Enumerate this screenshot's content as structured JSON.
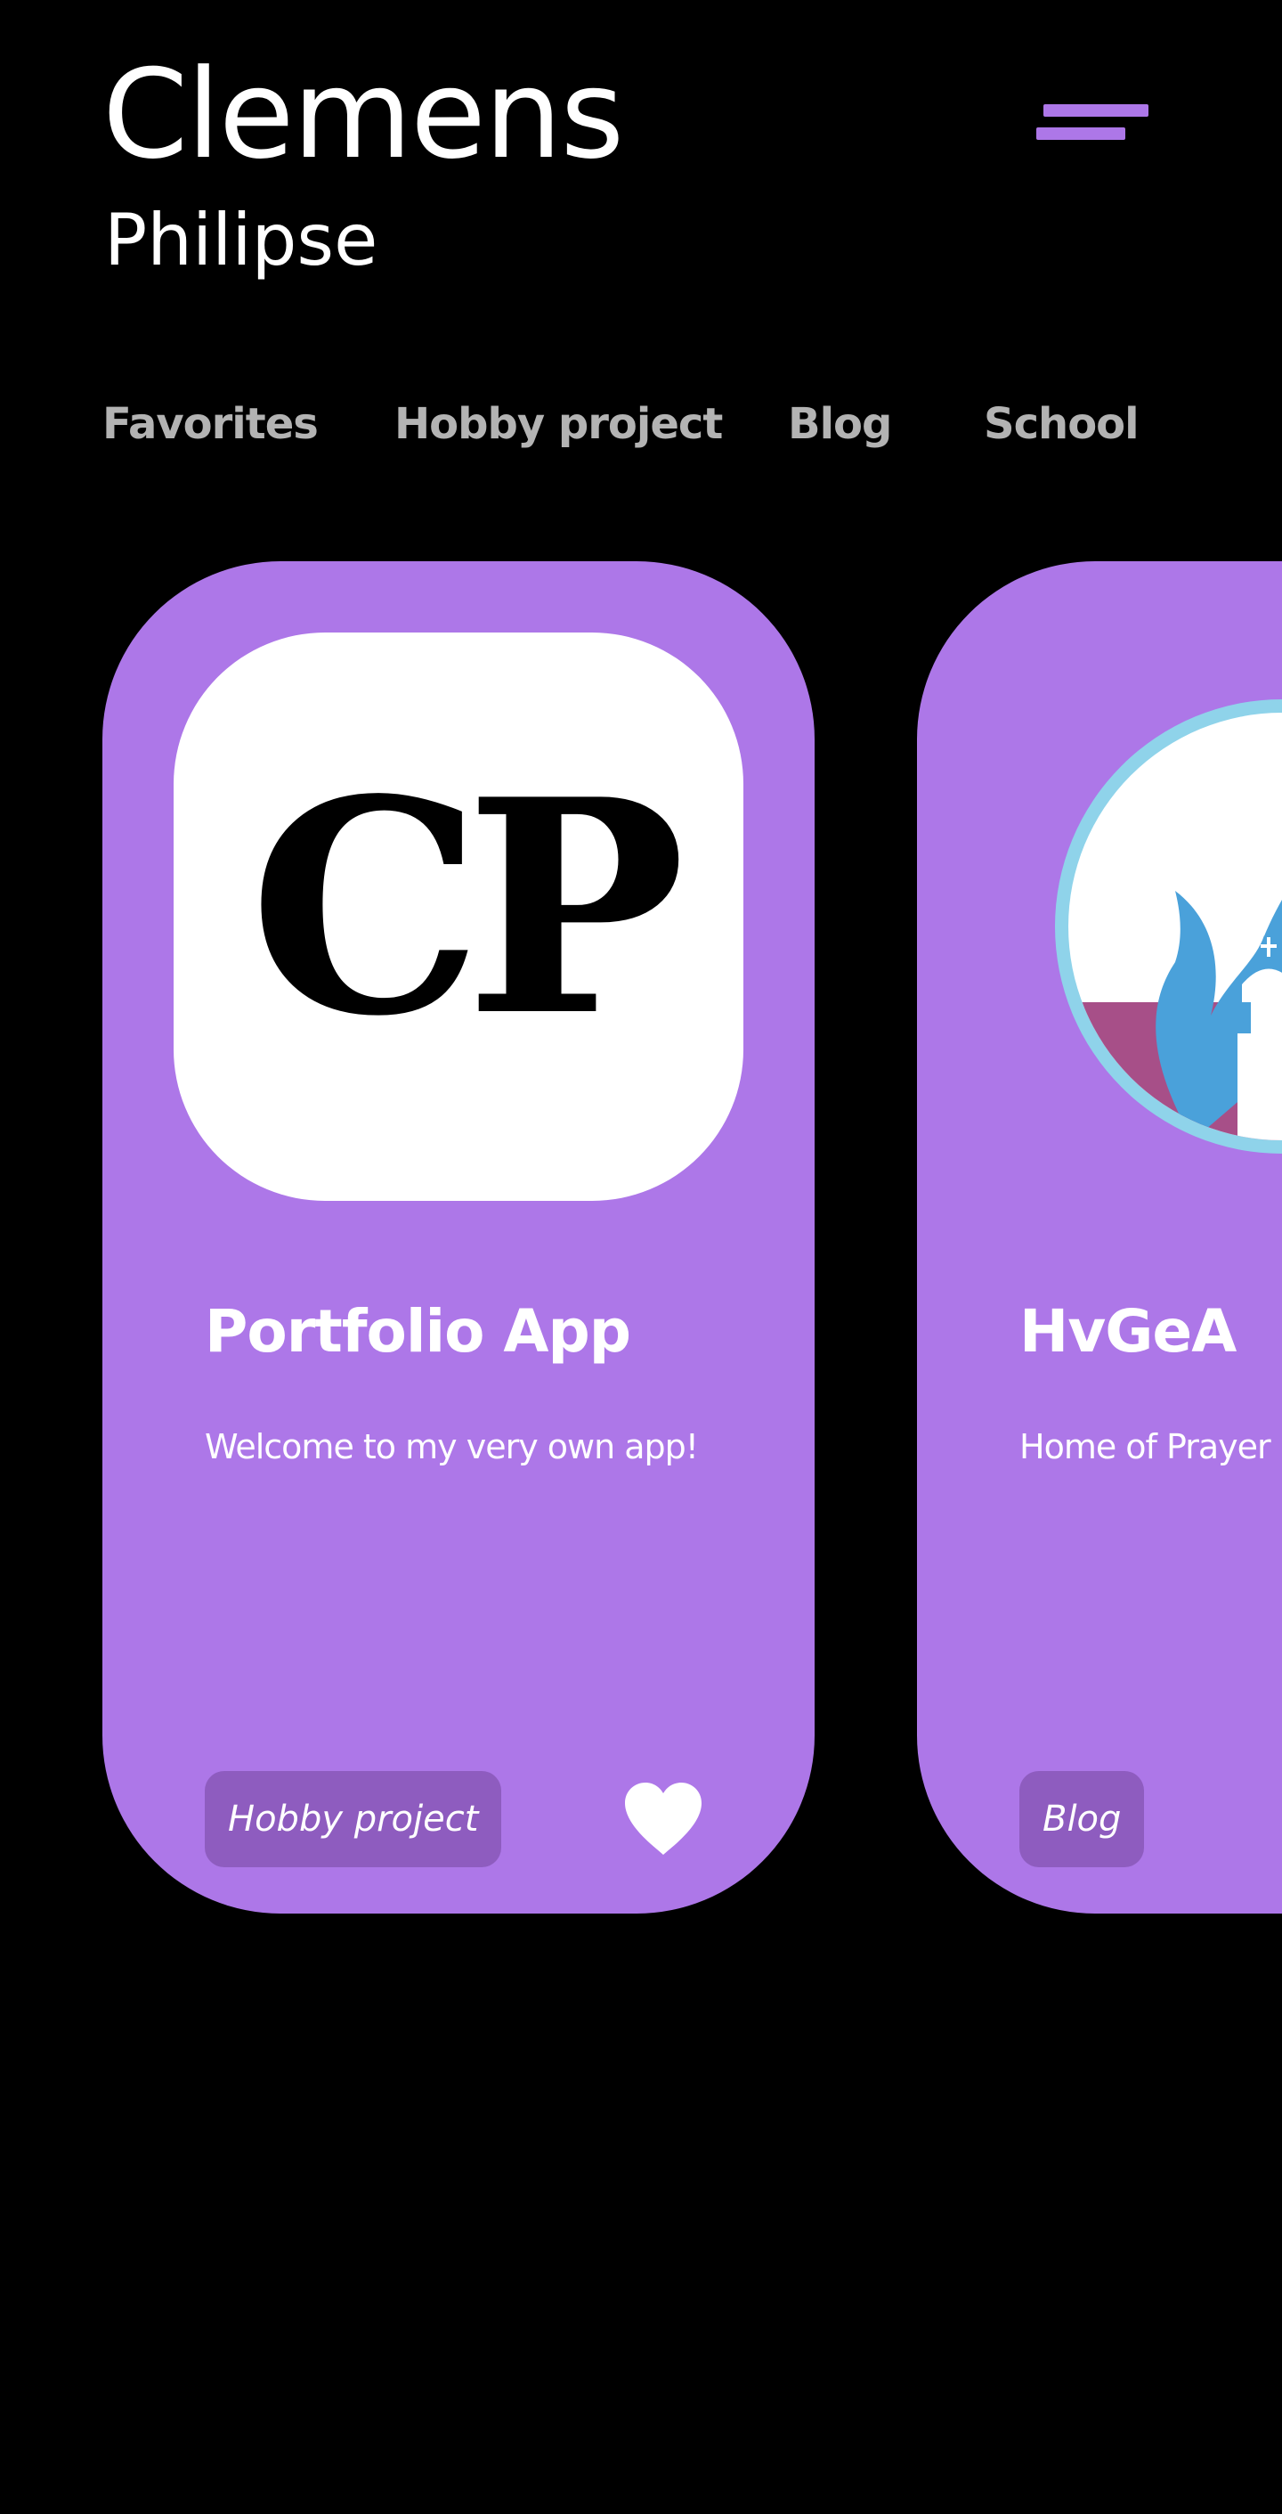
{
  "header": {
    "name": "Clemens",
    "surname": "Philipse"
  },
  "colors": {
    "accent": "#ad77e8",
    "card_bg": "#ad77e8",
    "tag_bg": "#8e5cbf",
    "tab_text": "#b3b3b3",
    "background": "#000000"
  },
  "tabs": [
    {
      "label": "Favorites"
    },
    {
      "label": "Hobby project"
    },
    {
      "label": "Blog"
    },
    {
      "label": "School"
    }
  ],
  "cards": [
    {
      "icon_text": "CP",
      "title": "Portfolio App",
      "description": "Welcome to my very own app!",
      "tag": "Hobby project",
      "favorite": true
    },
    {
      "icon": "church-flame-logo-icon",
      "title": "HvGeA",
      "description": "Home of Prayer a",
      "tag": "Blog"
    }
  ],
  "icons": {
    "menu": "hamburger-menu-icon",
    "favorite": "heart-icon"
  }
}
